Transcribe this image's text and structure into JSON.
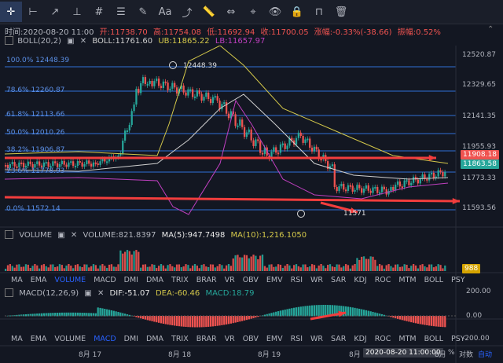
{
  "toolbar": {
    "icons": [
      "crosshair-icon",
      "horizontal-line-icon",
      "trend-line-icon",
      "vertical-line-icon",
      "hash-icon",
      "fibonacci-icon",
      "brush-icon",
      "text-icon",
      "path-icon",
      "ruler-icon",
      "measure-icon",
      "pin-icon",
      "eye-icon",
      "lock-icon",
      "magnet-icon",
      "trash-icon"
    ],
    "text_tool": "Aa"
  },
  "info": {
    "time": "时间:2020-08-20 11:00",
    "open": "开:11738.70",
    "high": "高:11754.08",
    "low": "低:11692.94",
    "close": "收:11700.05",
    "change": "涨幅:-0.33%(-38.66)",
    "amplitude": "振幅:0.52%"
  },
  "boll": {
    "name": "BOLL(20,2)",
    "boll": "BOLL:11761.60",
    "ub": "UB:11865.22",
    "lb": "LB:11657.97"
  },
  "fib_levels": [
    "100.0% 12448.39",
    "78.6% 12260.87",
    "61.8% 12113.66",
    "50.0% 12010.26",
    "38.2% 11906.87",
    "23.6% 11778.93",
    "0.0% 11572.14"
  ],
  "price_axis": [
    "12520.87",
    "12329.65",
    "12141.35",
    "11955.93",
    "11773.33",
    "11593.56"
  ],
  "price_tags": {
    "red": "11908.18",
    "green": "11863.58"
  },
  "high_marker": "12448.39",
  "low_marker": "11571",
  "volume": {
    "name": "VOLUME",
    "value": "VOLUME:821.8397",
    "ma5": "MA(5):947.7498",
    "ma10": "MA(10):1,216.1050",
    "tag": "988"
  },
  "tabs_row1": [
    "MA",
    "EMA",
    "VOLUME",
    "MACD",
    "DMI",
    "DMA",
    "TRIX",
    "BRAR",
    "VR",
    "OBV",
    "EMV",
    "RSI",
    "WR",
    "SAR",
    "KDJ",
    "ROC",
    "MTM",
    "BOLL",
    "PSY"
  ],
  "tabs_row2": [
    "MA",
    "EMA",
    "VOLUME",
    "MACD",
    "DMI",
    "DMA",
    "TRIX",
    "BRAR",
    "VR",
    "OBV",
    "EMV",
    "RSI",
    "WR",
    "SAR",
    "KDJ",
    "ROC",
    "MTM",
    "BOLL",
    "PSY"
  ],
  "active_tab1": "VOLUME",
  "active_tab2": "MACD",
  "macd": {
    "name": "MACD(12,26,9)",
    "dif": "DIF:-51.07",
    "dea": "DEA:-60.46",
    "macd": "MACD:18.79",
    "axis": [
      "200.00",
      "0.00",
      "-200.00"
    ]
  },
  "time_axis": [
    "8月 17",
    "8月 18",
    "8月 19",
    "8月 2"
  ],
  "crosshair_time": "2020-08-20 11:00:00",
  "bottom_right": {
    "pct": "%",
    "log": "对数",
    "auto": "自动",
    "partial": "8月"
  },
  "colors": {
    "up": "#26a69a",
    "down": "#ef5350",
    "ub": "#d4c84a",
    "lb": "#c040c0",
    "mid": "#cfcfcf",
    "arrow": "#f23d3d",
    "fib": "#2f6fd6"
  }
}
